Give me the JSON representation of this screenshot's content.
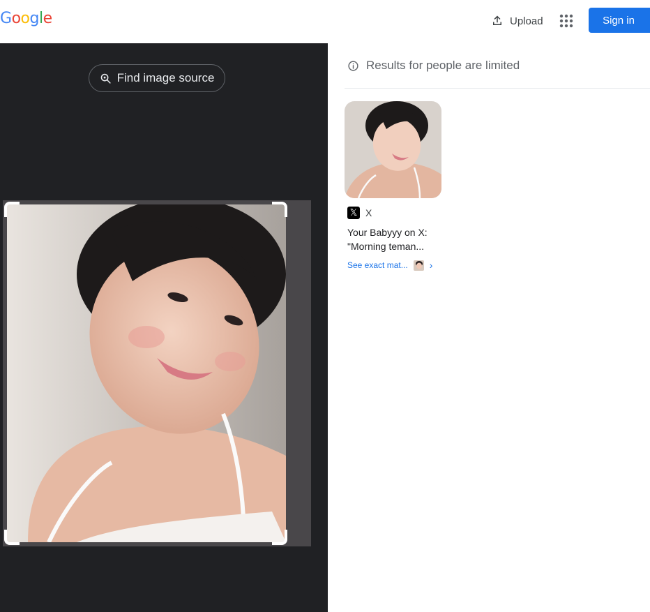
{
  "header": {
    "logo_letters": [
      {
        "char": "G",
        "color": "#4285F4"
      },
      {
        "char": "o",
        "color": "#EA4335"
      },
      {
        "char": "o",
        "color": "#FBBC05"
      },
      {
        "char": "g",
        "color": "#4285F4"
      },
      {
        "char": "l",
        "color": "#34A853"
      },
      {
        "char": "e",
        "color": "#EA4335"
      }
    ],
    "upload_label": "Upload",
    "upload_icon": "upload-icon",
    "apps_icon": "apps-grid-icon",
    "signin_label": "Sign in"
  },
  "left_panel": {
    "find_source_label": "Find image source",
    "find_source_icon": "lens-search-icon"
  },
  "results": {
    "notice": "Results for people are limited",
    "notice_icon": "info-icon",
    "items": [
      {
        "source_name": "X",
        "source_icon": "x-logo-icon",
        "title_line1": "Your Babyyy on X:",
        "title_line2": "\"Morning teman...",
        "exact_match_label": "See exact mat...",
        "chevron": "›"
      }
    ]
  },
  "colors": {
    "dark_panel": "#202124",
    "accent": "#1a73e8"
  }
}
